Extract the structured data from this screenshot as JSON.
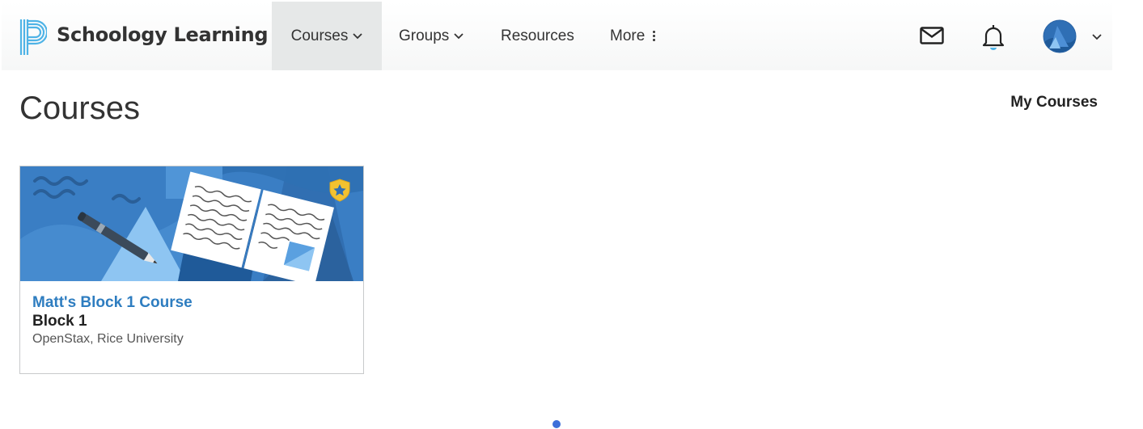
{
  "header": {
    "brand": "Schoology Learning",
    "nav": [
      {
        "label": "Courses",
        "has_dropdown": true,
        "active": true
      },
      {
        "label": "Groups",
        "has_dropdown": true,
        "active": false
      },
      {
        "label": "Resources",
        "has_dropdown": false,
        "active": false
      },
      {
        "label": "More",
        "has_dropdown": false,
        "active": false
      }
    ],
    "icons": [
      "mail-icon",
      "bell-icon",
      "avatar",
      "chevron-down-icon"
    ]
  },
  "page": {
    "title": "Courses",
    "my_courses_link": "My Courses"
  },
  "courses": [
    {
      "title": "Matt's Block 1 Course",
      "section": "Block 1",
      "organization": "OpenStax, Rice University",
      "badge": "star-shield-icon"
    }
  ],
  "colors": {
    "brand_blue": "#2e7dc0",
    "banner_blue": "#3a7ec4",
    "badge_gold": "#f2c230",
    "loading_dot": "#3d6fd9"
  }
}
